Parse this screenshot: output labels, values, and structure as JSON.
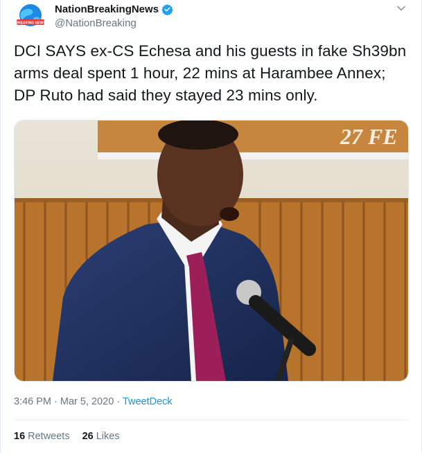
{
  "tweet": {
    "display_name": "NationBreakingNews",
    "handle": "@NationBreaking",
    "avatar_text": "BREAKING NEWS",
    "text": "DCI SAYS ex-CS Echesa and his guests in fake Sh39bn arms deal spent 1 hour, 22 mins at Harambee Annex; DP Ruto had said they stayed 23 mins only.",
    "media_banner_text": "27 FE",
    "time": "3:46 PM",
    "date": "Mar 5, 2020",
    "source": "TweetDeck",
    "retweets_count": "16",
    "retweets_label": "Retweets",
    "likes_count": "26",
    "likes_label": "Likes"
  },
  "colors": {
    "link": "#1b95e0",
    "verified": "#1da1f2",
    "secondary_text": "#657786"
  },
  "icons": [
    "globe-logo-icon",
    "verified-badge-icon",
    "chevron-down-icon"
  ]
}
